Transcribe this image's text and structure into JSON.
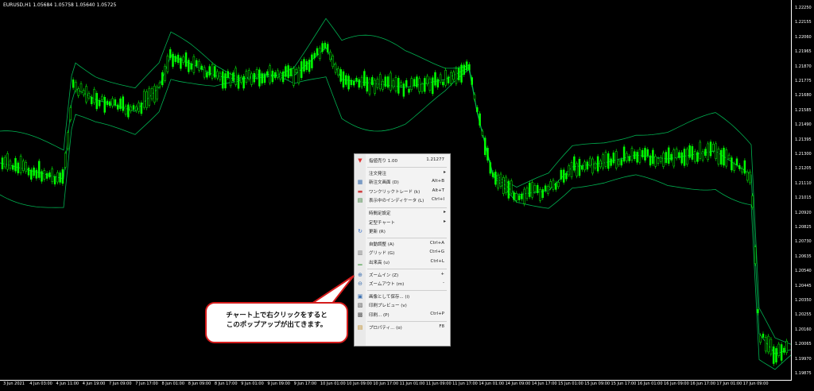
{
  "chart": {
    "title": "EURUSD,H1  1.05684 1.05758 1.05640 1.05725",
    "price_labels": [
      "1.22250",
      "1.22155",
      "1.22060",
      "1.21965",
      "1.21870",
      "1.21775",
      "1.21680",
      "1.21585",
      "1.21490",
      "1.21395",
      "1.21300",
      "1.21205",
      "1.21110",
      "1.21015",
      "1.20920",
      "1.20825",
      "1.20730",
      "1.20635",
      "1.20540",
      "1.20445",
      "1.20350",
      "1.20255",
      "1.20160",
      "1.20065",
      "1.19970",
      "1.19875"
    ],
    "time_labels": [
      "3 Jun 2021",
      "4 Jun 03:00",
      "4 Jun 11:00",
      "4 Jun 19:00",
      "7 Jun 09:00",
      "7 Jun 17:00",
      "8 Jun 01:00",
      "8 Jun 09:00",
      "8 Jun 17:00",
      "9 Jun 01:00",
      "9 Jun 09:00",
      "9 Jun 17:00",
      "10 Jun 01:00",
      "10 Jun 09:00",
      "10 Jun 17:00",
      "11 Jun 01:00",
      "11 Jun 09:00",
      "11 Jun 17:00",
      "14 Jun 01:00",
      "14 Jun 09:00",
      "14 Jun 17:00",
      "15 Jun 01:00",
      "15 Jun 09:00",
      "15 Jun 17:00",
      "16 Jun 01:00",
      "16 Jun 09:00",
      "16 Jun 17:00",
      "17 Jun 01:00",
      "17 Jun 09:00"
    ],
    "colors": {
      "background": "#000000",
      "candle": "#00ff00",
      "band": "#00b050"
    }
  },
  "menu": {
    "items": [
      {
        "icon": "sell-arrow-icon",
        "label": "指値売り 1.00",
        "shortcut": "1.21277"
      },
      {
        "icon": "",
        "label": "注文発注",
        "submenu": "▸"
      },
      {
        "icon": "new-order-icon",
        "label": "新注文画面 (D)",
        "shortcut": "Alt+B"
      },
      {
        "icon": "one-click-icon",
        "label": "ワンクリックトレード (k)",
        "shortcut": "Alt+T"
      },
      {
        "icon": "indicator-list-icon",
        "label": "表示中のインディケータ (L)",
        "shortcut": "Ctrl+I"
      },
      {
        "icon": "",
        "label": "時間足設定",
        "submenu": "▸"
      },
      {
        "icon": "",
        "label": "定型チャート",
        "submenu": "▸"
      },
      {
        "icon": "refresh-icon",
        "label": "更新 (R)",
        "shortcut": ""
      },
      {
        "icon": "",
        "label": "自動調整 (A)",
        "shortcut": "Ctrl+A"
      },
      {
        "icon": "grid-icon",
        "label": "グリッド (G)",
        "shortcut": "Ctrl+G"
      },
      {
        "icon": "volume-icon",
        "label": "出来高 (u)",
        "shortcut": "Ctrl+L"
      },
      {
        "icon": "zoom-in-icon",
        "label": "ズームイン (Z)",
        "shortcut": "+"
      },
      {
        "icon": "zoom-out-icon",
        "label": "ズームアウト (m)",
        "shortcut": "-"
      },
      {
        "icon": "save-image-icon",
        "label": "画像として保存... (i)",
        "shortcut": ""
      },
      {
        "icon": "print-preview-icon",
        "label": "印刷プレビュー (v)",
        "shortcut": ""
      },
      {
        "icon": "print-icon",
        "label": "印刷... (P)",
        "shortcut": "Ctrl+P"
      },
      {
        "icon": "properties-icon",
        "label": "プロパティ... (o)",
        "shortcut": "F8"
      }
    ]
  },
  "callout": {
    "line1": "チャート上で右クリックをすると",
    "line2": "このポップアップが出てきます。"
  }
}
